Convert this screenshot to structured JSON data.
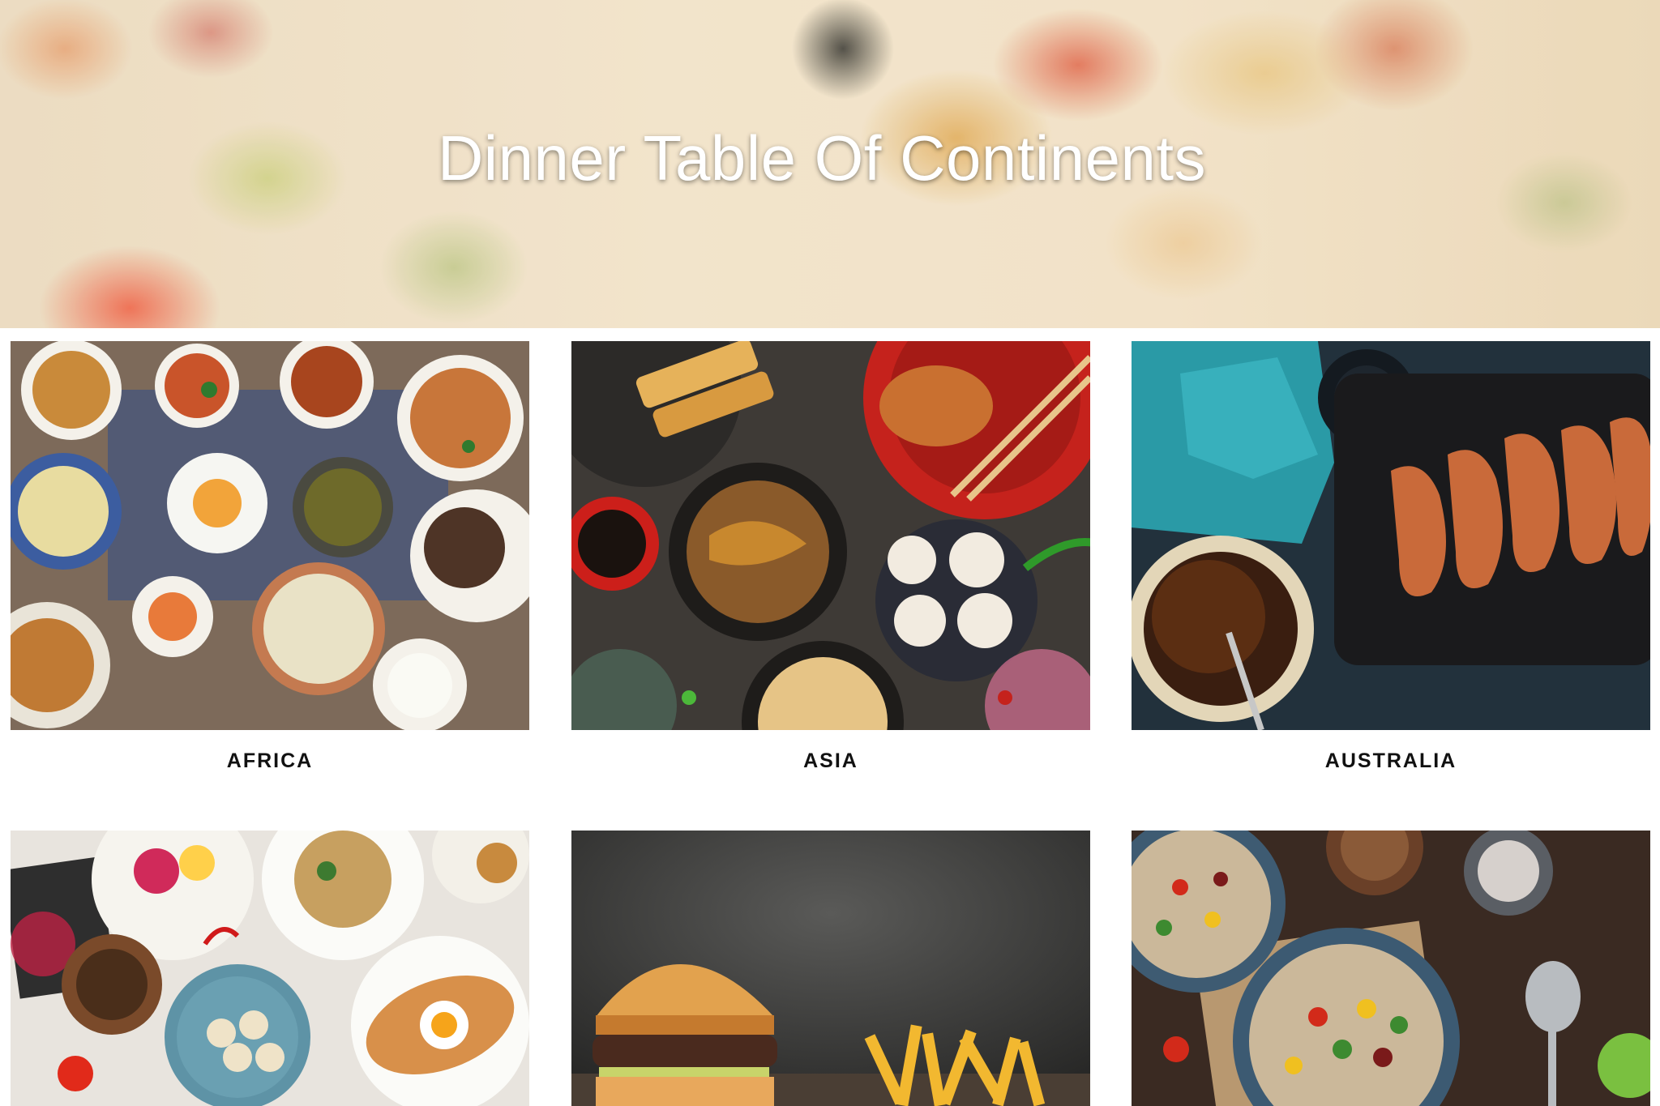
{
  "hero": {
    "title": "Dinner Table Of Continents"
  },
  "cards": [
    {
      "label": "AFRICA"
    },
    {
      "label": "ASIA"
    },
    {
      "label": "AUSTRALIA"
    },
    {
      "label": ""
    },
    {
      "label": ""
    },
    {
      "label": ""
    }
  ],
  "colors": {
    "title_text": "#ffffff",
    "label_text": "#111111",
    "background": "#ffffff"
  }
}
